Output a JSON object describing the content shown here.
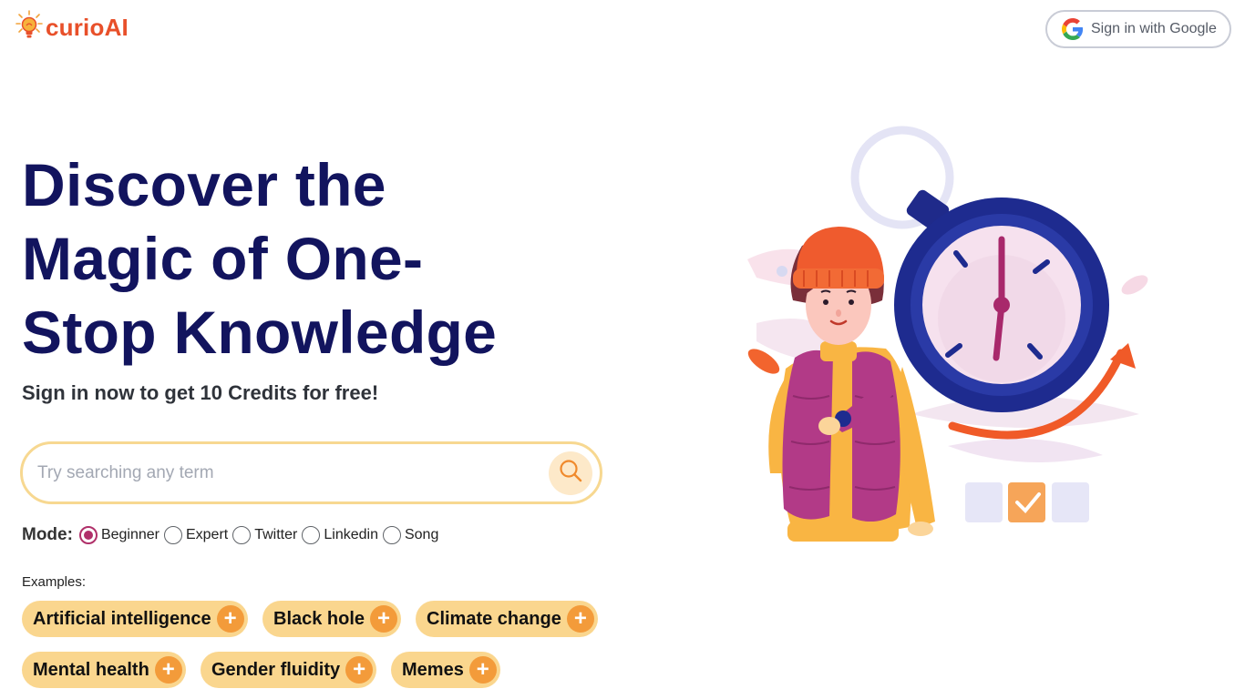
{
  "header": {
    "logo_text": "curioAI",
    "logo_icon": "lightbulb-icon",
    "signin_label": "Sign in with Google",
    "signin_icon": "google-icon"
  },
  "hero": {
    "title_lines": [
      "Discover the",
      "Magic of One-",
      "Stop Knowledge"
    ],
    "subtitle": "Sign in now to get 10 Credits for free!"
  },
  "search": {
    "placeholder": "Try searching any term",
    "value": "",
    "icon": "search-icon"
  },
  "mode": {
    "label": "Mode:",
    "options": [
      {
        "label": "Beginner",
        "selected": true
      },
      {
        "label": "Expert",
        "selected": false
      },
      {
        "label": "Twitter",
        "selected": false
      },
      {
        "label": "Linkedin",
        "selected": false
      },
      {
        "label": "Song",
        "selected": false
      }
    ]
  },
  "examples": {
    "label": "Examples:",
    "chips": [
      {
        "label": "Artificial intelligence"
      },
      {
        "label": "Black hole"
      },
      {
        "label": "Climate change"
      },
      {
        "label": "Mental health"
      },
      {
        "label": "Gender fluidity"
      },
      {
        "label": "Memes"
      }
    ],
    "add_icon": "plus-icon"
  },
  "colors": {
    "brand": "#e8502a",
    "title": "#12145e",
    "chip": "#fad68e",
    "chip_plus": "#f39b3a",
    "radio_selected": "#b0306a",
    "search_border": "#f7d891"
  },
  "illustration": {
    "icon": "stopwatch-woman-illustration"
  }
}
